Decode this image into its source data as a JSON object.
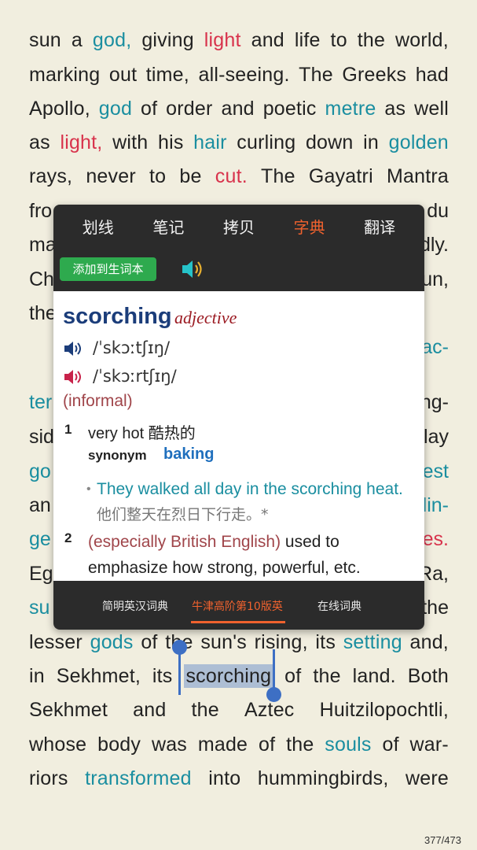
{
  "reader": {
    "lines": [
      {
        "words": [
          {
            "t": "sun"
          },
          {
            "t": "a"
          },
          {
            "t": "god,",
            "c": "blue"
          },
          {
            "t": "giving"
          },
          {
            "t": "light",
            "c": "red"
          },
          {
            "t": "and"
          },
          {
            "t": "life"
          },
          {
            "t": "to"
          },
          {
            "t": "the"
          },
          {
            "t": "world,"
          }
        ]
      },
      {
        "words": [
          {
            "t": "marking"
          },
          {
            "t": "out"
          },
          {
            "t": "time,"
          },
          {
            "t": "all-seeing."
          },
          {
            "t": "The"
          },
          {
            "t": "Greeks"
          },
          {
            "t": "had"
          }
        ]
      },
      {
        "words": [
          {
            "t": "Apollo,"
          },
          {
            "t": "god",
            "c": "blue"
          },
          {
            "t": "of"
          },
          {
            "t": "order"
          },
          {
            "t": "and"
          },
          {
            "t": "poetic"
          },
          {
            "t": "metre",
            "c": "blue"
          },
          {
            "t": "as"
          },
          {
            "t": "well"
          }
        ]
      },
      {
        "words": [
          {
            "t": "as"
          },
          {
            "t": "light,",
            "c": "red"
          },
          {
            "t": "with"
          },
          {
            "t": "his"
          },
          {
            "t": "hair",
            "c": "blue"
          },
          {
            "t": "curling"
          },
          {
            "t": "down"
          },
          {
            "t": "in"
          },
          {
            "t": "golden",
            "c": "blue"
          }
        ]
      },
      {
        "words": [
          {
            "t": "rays,"
          },
          {
            "t": "never"
          },
          {
            "t": "to"
          },
          {
            "t": "be"
          },
          {
            "t": "cut.",
            "c": "red"
          },
          {
            "t": "The"
          },
          {
            "t": "Gayatri"
          },
          {
            "t": "Mantra"
          }
        ]
      }
    ],
    "lines_after": [
      {
        "words": [
          {
            "t": "lesser"
          },
          {
            "t": "gods",
            "c": "blue"
          },
          {
            "t": "of"
          },
          {
            "t": "the"
          },
          {
            "t": "sun's"
          },
          {
            "t": "rising,"
          },
          {
            "t": "its"
          },
          {
            "t": "setting",
            "c": "blue"
          },
          {
            "t": "and,"
          }
        ]
      },
      {
        "words": [
          {
            "t": "in"
          },
          {
            "t": "Sekhmet,"
          },
          {
            "t": "its"
          },
          {
            "t": "scorching",
            "c": "sel"
          },
          {
            "t": "of"
          },
          {
            "t": "the"
          },
          {
            "t": "land."
          },
          {
            "t": "Both"
          }
        ]
      },
      {
        "words": [
          {
            "t": "Sekhmet"
          },
          {
            "t": "and"
          },
          {
            "t": "the"
          },
          {
            "t": "Aztec"
          },
          {
            "t": "Huitzilopochtli,"
          }
        ]
      },
      {
        "words": [
          {
            "t": "whose"
          },
          {
            "t": "body"
          },
          {
            "t": "was"
          },
          {
            "t": "made"
          },
          {
            "t": "of"
          },
          {
            "t": "the"
          },
          {
            "t": "souls",
            "c": "blue"
          },
          {
            "t": "of"
          },
          {
            "t": "war-"
          }
        ]
      },
      {
        "words": [
          {
            "t": "riors"
          },
          {
            "t": "transformed",
            "c": "blue"
          },
          {
            "t": "into"
          },
          {
            "t": "hummingbirds,"
          },
          {
            "t": "were"
          }
        ]
      }
    ],
    "fragments": {
      "left": [
        "fro",
        "ma",
        "Ch",
        "the",
        "",
        "ter",
        "sid",
        "go",
        "an",
        "ge",
        "Eg",
        "su"
      ],
      "right": [
        "du",
        "dly.",
        "un,",
        "",
        "ac-",
        "ng-",
        "lay",
        "est",
        "lin-",
        "es.",
        "Ra,",
        "the"
      ]
    },
    "page_indicator": "377/473"
  },
  "popup": {
    "menu": [
      "划线",
      "笔记",
      "拷贝",
      "字典",
      "翻译"
    ],
    "active_menu": "字典",
    "add_button": "添加到生词本",
    "entry": {
      "headword": "scorching",
      "pos": "adjective",
      "pron_uk": "/ˈskɔːtʃɪŋ/",
      "pron_us": "/ˈskɔːrtʃɪŋ/",
      "register": "(informal)",
      "sense1_num": "1",
      "sense1_def": "very hot 酷热的",
      "synonym_label": "synonym",
      "synonym_word": "baking",
      "example_en": "They walked all day in the scorching heat.",
      "example_zh": "他们整天在烈日下行走。*",
      "sense2_num": "2",
      "sense2_label": "(especially British English)",
      "sense2_def": " used to emphasize how strong, powerful, etc."
    },
    "dict_tabs": [
      "简明英汉词典",
      "牛津高阶第10版英",
      "在线词典"
    ],
    "active_dict_tab": "牛津高阶第10版英"
  },
  "colors": {
    "background": "#f1eedf",
    "link_blue": "#1a8ea0",
    "highlight_red": "#d8334c",
    "accent_orange": "#f0622e",
    "add_green": "#2eaa4e",
    "selection_blue": "#3d6fc4"
  }
}
